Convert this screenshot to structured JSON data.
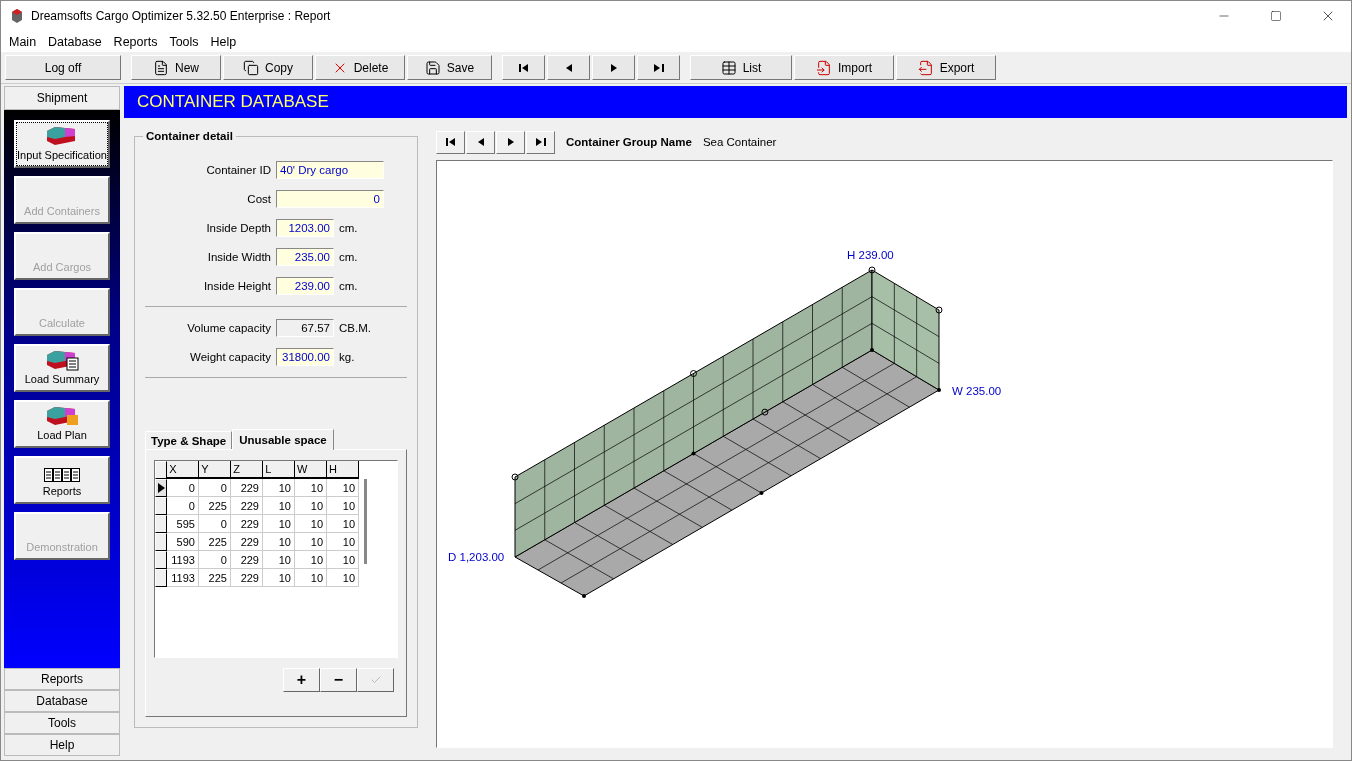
{
  "window": {
    "title": "Dreamsofts Cargo Optimizer 5.32.50 Enterprise : Report"
  },
  "menu": [
    "Main",
    "Database",
    "Reports",
    "Tools",
    "Help"
  ],
  "toolbar": {
    "logoff": "Log off",
    "edit": [
      "New",
      "Copy",
      "Delete",
      "Save"
    ],
    "data": [
      "List",
      "Import",
      "Export"
    ]
  },
  "sidebar": {
    "header": "Shipment",
    "items": [
      {
        "label": "Input Specification",
        "disabled": false,
        "selected": true
      },
      {
        "label": "Add Containers",
        "disabled": true,
        "selected": false
      },
      {
        "label": "Add Cargos",
        "disabled": true,
        "selected": false
      },
      {
        "label": "Calculate",
        "disabled": true,
        "selected": false
      },
      {
        "label": "Load Summary",
        "disabled": false,
        "selected": false
      },
      {
        "label": "Load Plan",
        "disabled": false,
        "selected": false
      },
      {
        "label": "Reports",
        "disabled": false,
        "selected": false
      },
      {
        "label": "Demonstration",
        "disabled": true,
        "selected": false
      }
    ],
    "sections": [
      "Reports",
      "Database",
      "Tools",
      "Help"
    ]
  },
  "header": "CONTAINER DATABASE",
  "detail": {
    "title": "Container detail",
    "sections": [
      [
        {
          "label": "Container ID",
          "value": "40' Dry cargo",
          "readonly": false
        },
        {
          "label": "Cost",
          "value": "0",
          "readonly": false
        },
        {
          "label": "Inside Depth",
          "value": "1203.00",
          "unit": "cm.",
          "readonly": false
        },
        {
          "label": "Inside Width",
          "value": "235.00",
          "unit": "cm.",
          "readonly": false
        },
        {
          "label": "Inside Height",
          "value": "239.00",
          "unit": "cm.",
          "readonly": false
        }
      ],
      [
        {
          "label": "Volume capacity",
          "value": "67.57",
          "unit": "CB.M.",
          "readonly": true
        },
        {
          "label": "Weight capacity",
          "value": "31800.00",
          "unit": "kg.",
          "readonly": false
        }
      ]
    ]
  },
  "tabs": [
    {
      "label": "Type & Shape",
      "selected": false
    },
    {
      "label": "Unusable space",
      "selected": true
    }
  ],
  "table": {
    "columns": [
      "X",
      "Y",
      "Z",
      "L",
      "W",
      "H"
    ],
    "rows": [
      {
        "cells": [
          "0",
          "0",
          "229",
          "10",
          "10",
          "10"
        ],
        "selected": true
      },
      {
        "cells": [
          "0",
          "225",
          "229",
          "10",
          "10",
          "10"
        ],
        "selected": false
      },
      {
        "cells": [
          "595",
          "0",
          "229",
          "10",
          "10",
          "10"
        ],
        "selected": false
      },
      {
        "cells": [
          "590",
          "225",
          "229",
          "10",
          "10",
          "10"
        ],
        "selected": false
      },
      {
        "cells": [
          "1193",
          "0",
          "229",
          "10",
          "10",
          "10"
        ],
        "selected": false
      },
      {
        "cells": [
          "1193",
          "225",
          "229",
          "10",
          "10",
          "10"
        ],
        "selected": false
      }
    ]
  },
  "grid_buttons": [
    {
      "label": "+",
      "disabled": false
    },
    {
      "label": "−",
      "disabled": false
    },
    {
      "disabled": true
    }
  ],
  "group": {
    "label": "Container Group Name",
    "value": "Sea Container"
  },
  "view": {
    "height_label": "H 239.00",
    "width_label": "W 235.00",
    "depth_label": "D 1,203.00"
  }
}
